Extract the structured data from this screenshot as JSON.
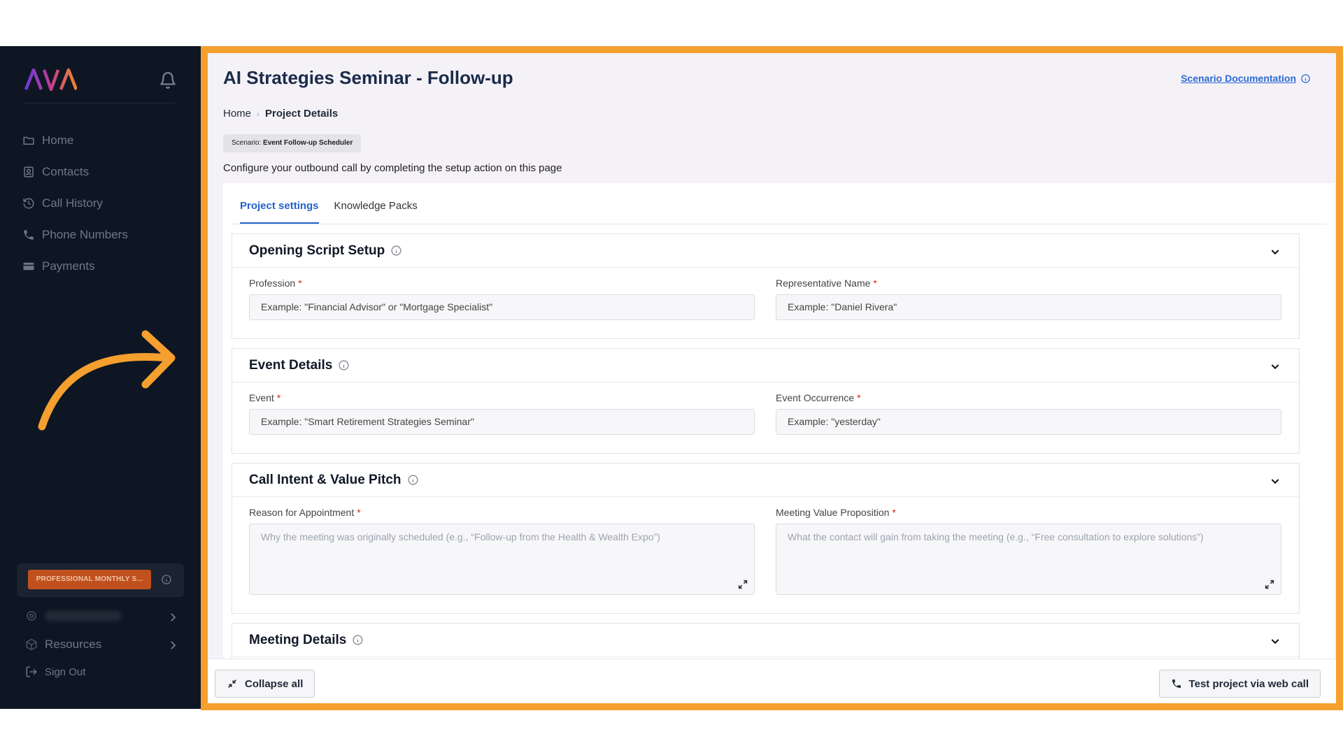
{
  "sidebar": {
    "logo_text": "AVA",
    "nav": [
      {
        "label": "Home",
        "icon": "folder-icon"
      },
      {
        "label": "Contacts",
        "icon": "contacts-icon"
      },
      {
        "label": "Call History",
        "icon": "history-icon"
      },
      {
        "label": "Phone Numbers",
        "icon": "phone-icon"
      },
      {
        "label": "Payments",
        "icon": "card-icon"
      }
    ],
    "plan_badge": "PROFESSIONAL MONTHLY S...",
    "resources_label": "Resources",
    "signout_label": "Sign Out"
  },
  "header": {
    "title": "AI Strategies Seminar - Follow-up",
    "doc_link": "Scenario Documentation",
    "breadcrumb": {
      "home": "Home",
      "current": "Project Details"
    },
    "scenario_prefix": "Scenario:",
    "scenario_name": "Event Follow-up Scheduler",
    "config_text": "Configure your outbound call by completing the setup action on this page"
  },
  "tabs": [
    "Project settings",
    "Knowledge Packs"
  ],
  "sections": {
    "opening": {
      "title": "Opening Script Setup",
      "profession_label": "Profession",
      "profession_placeholder": "Example: \"Financial Advisor\" or \"Mortgage Specialist\"",
      "rep_label": "Representative Name",
      "rep_placeholder": "Example: \"Daniel Rivera\""
    },
    "event": {
      "title": "Event Details",
      "event_label": "Event",
      "event_placeholder": "Example: \"Smart Retirement Strategies Seminar\"",
      "occurrence_label": "Event Occurrence",
      "occurrence_placeholder": "Example: \"yesterday\""
    },
    "intent": {
      "title": "Call Intent & Value Pitch",
      "reason_label": "Reason for Appointment",
      "reason_placeholder": "Why the meeting was originally scheduled (e.g., “Follow-up from the Health & Wealth Expo”)",
      "value_label": "Meeting Value Proposition",
      "value_placeholder": "What the contact will gain from taking the meeting (e.g., “Free consultation to explore solutions”)"
    },
    "meeting": {
      "title": "Meeting Details"
    }
  },
  "footer": {
    "collapse_label": "Collapse all",
    "test_label": "Test project via web call"
  },
  "colors": {
    "frame_accent": "#f59f2f",
    "sidebar_bg": "#0f1623",
    "link_blue": "#2563c9",
    "required_red": "#e11d1d"
  }
}
